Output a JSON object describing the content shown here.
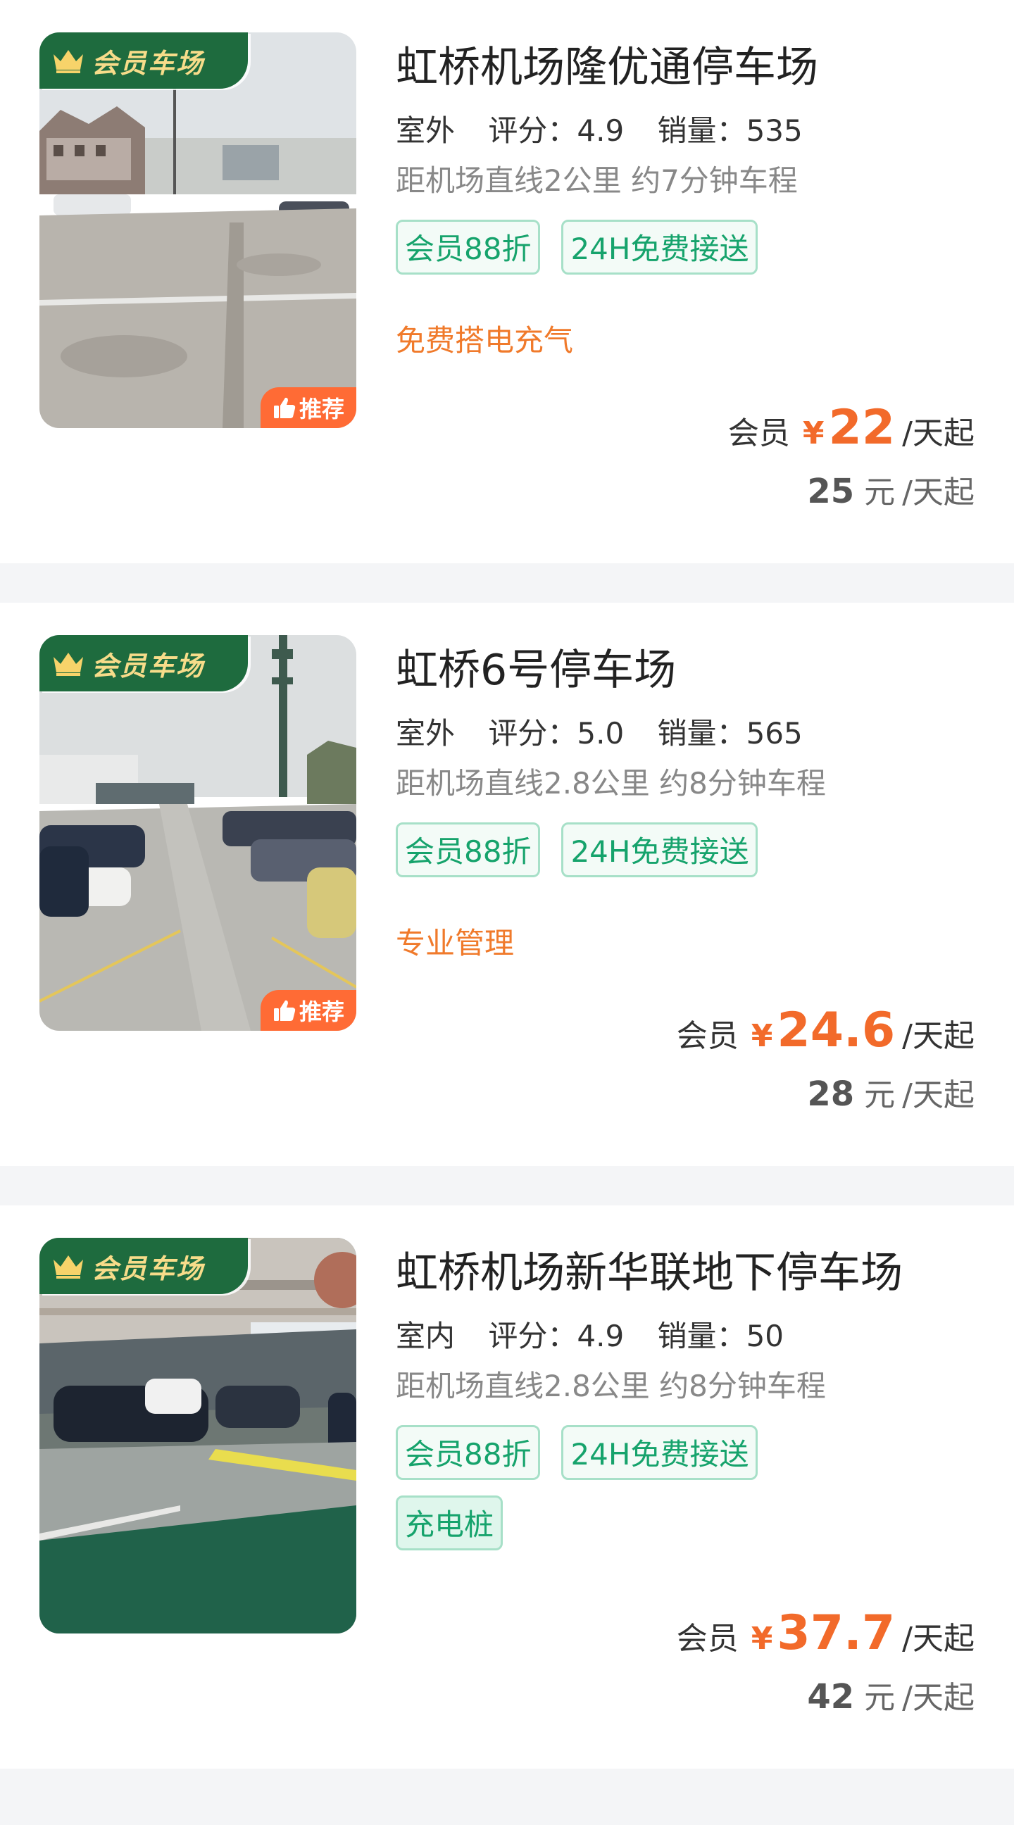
{
  "badges": {
    "vip": "会员车场",
    "recommend": "推荐"
  },
  "labels": {
    "rating_prefix": "评分：",
    "sales_prefix": "销量：",
    "member": "会员",
    "yen": "¥",
    "per_day_from": "/天起",
    "yuan": "元"
  },
  "colors": {
    "accent_green": "#16a36c",
    "price_orange": "#f26a2a",
    "vip_badge_bg": "#1e6b3e",
    "recommend_bg": "#ff6b35"
  },
  "lots": [
    {
      "title": "虹桥机场隆优通停车场",
      "env": "室外",
      "rating": "4.9",
      "sales": "535",
      "distance": "距机场直线2公里 约7分钟车程",
      "tags": [
        "会员88折",
        "24H免费接送"
      ],
      "highlight": "免费搭电充气",
      "member_price": "22",
      "original_price": "25",
      "recommended": true,
      "photo": "outdoor-lot"
    },
    {
      "title": "虹桥6号停车场",
      "env": "室外",
      "rating": "5.0",
      "sales": "565",
      "distance": "距机场直线2.8公里 约8分钟车程",
      "tags": [
        "会员88折",
        "24H免费接送"
      ],
      "highlight": "专业管理",
      "member_price": "24.6",
      "original_price": "28",
      "recommended": true,
      "photo": "outdoor-rows"
    },
    {
      "title": "虹桥机场新华联地下停车场",
      "env": "室内",
      "rating": "4.9",
      "sales": "50",
      "distance": "距机场直线2.8公里 约8分钟车程",
      "tags": [
        "会员88折",
        "24H免费接送",
        "充电桩"
      ],
      "highlight": "",
      "member_price": "37.7",
      "original_price": "42",
      "recommended": false,
      "photo": "underground-lot"
    }
  ]
}
